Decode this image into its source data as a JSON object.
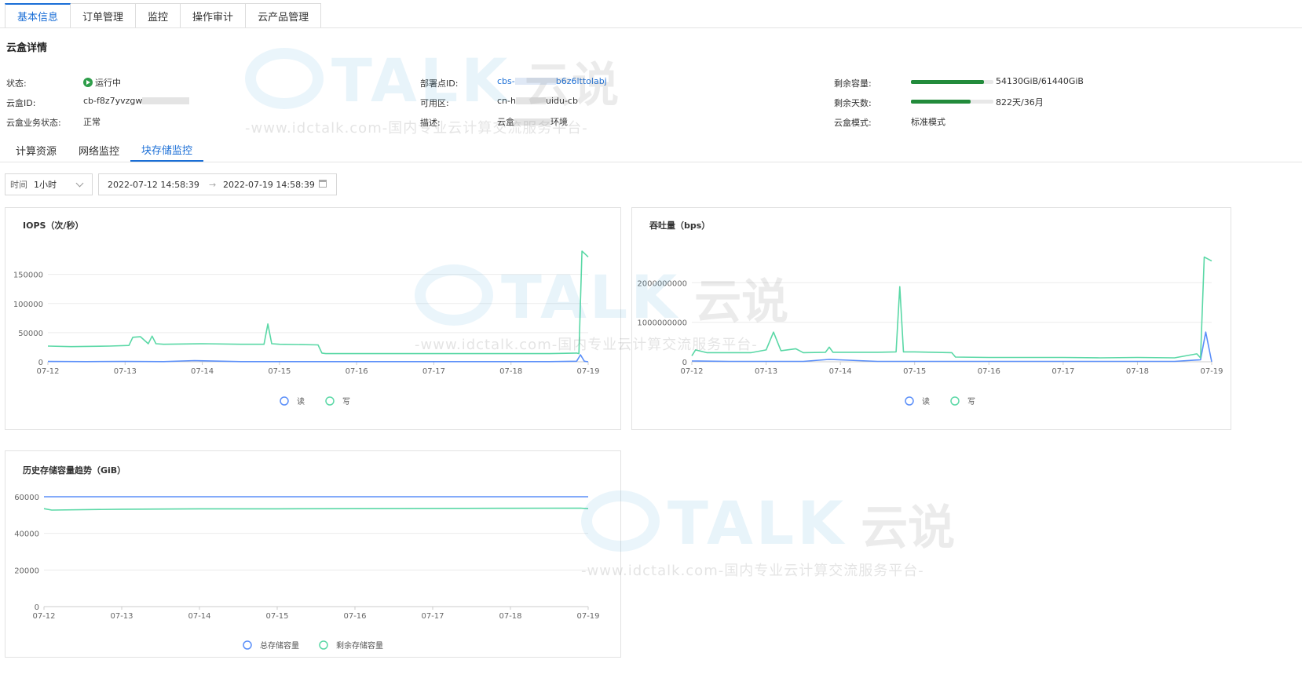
{
  "top_tabs": [
    "基本信息",
    "订单管理",
    "监控",
    "操作审计",
    "云产品管理"
  ],
  "section_title": "云盒详情",
  "info": {
    "status_label": "状态:",
    "status_value": "运行中",
    "id_label": "云盒ID:",
    "id_value": "cb-f8z7yvzgw",
    "biz_status_label": "云盒业务状态:",
    "biz_status_value": "正常",
    "node_label": "部署点ID:",
    "node_value": "cbs-",
    "node_value_tail": "b6z6lttolabj",
    "zone_label": "可用区:",
    "zone_value": "cn-h",
    "zone_value_tail": "uidu-cb",
    "desc_label": "描述:",
    "desc_value": "云盒",
    "desc_value_tail": "环境",
    "capacity_label": "剩余容量:",
    "capacity_value": "54130GiB/61440GiB",
    "capacity_fraction": 0.881,
    "days_label": "剩余天数:",
    "days_value": "822天/36月",
    "days_fraction": 0.72,
    "mode_label": "云盒模式:",
    "mode_value": "标准模式"
  },
  "sub_tabs": [
    "计算资源",
    "网络监控",
    "块存储监控"
  ],
  "filter": {
    "time_label": "时间",
    "time_value": "1小时",
    "start": "2022-07-12 14:58:39",
    "arrow": "→",
    "end": "2022-07-19 14:58:39"
  },
  "watermark": {
    "brand": "TALK",
    "cn": "云说",
    "sub": "-www.idctalk.com-国内专业云计算交流服务平台-"
  },
  "colors": {
    "accent": "#1a6ed6",
    "read": "#5b8ff9",
    "write": "#5ad8a6",
    "progress": "#228b3b"
  },
  "chart_data": [
    {
      "type": "line",
      "title": "IOPS（次/秒）",
      "x_ticks": [
        "07-12",
        "07-13",
        "07-14",
        "07-15",
        "07-16",
        "07-17",
        "07-18",
        "07-19"
      ],
      "y_ticks": [
        0,
        50000,
        100000,
        150000
      ],
      "ylim": [
        0,
        190000
      ],
      "xlim": [
        0,
        7
      ],
      "legend": "bottom",
      "series": [
        {
          "name": "读",
          "color": "#5b8ff9",
          "x": [
            0,
            0.5,
            1,
            1.5,
            1.9,
            2.5,
            3,
            3.5,
            4,
            4.5,
            5,
            5.5,
            6,
            6.5,
            6.85,
            6.9,
            6.95,
            7
          ],
          "y": [
            500,
            300,
            500,
            300,
            2000,
            300,
            300,
            300,
            300,
            300,
            300,
            300,
            300,
            300,
            1000,
            12000,
            1000,
            0
          ]
        },
        {
          "name": "写",
          "color": "#5ad8a6",
          "x": [
            0,
            0.3,
            0.8,
            1.05,
            1.1,
            1.2,
            1.3,
            1.35,
            1.4,
            1.5,
            2,
            2.5,
            2.8,
            2.85,
            2.9,
            3,
            3.5,
            3.55,
            3.6,
            4,
            4.5,
            5,
            5.5,
            6,
            6.5,
            6.85,
            6.88,
            6.92,
            6.96,
            7
          ],
          "y": [
            27000,
            26000,
            27000,
            28000,
            42000,
            43000,
            31000,
            44000,
            31000,
            30000,
            31000,
            30000,
            30000,
            65000,
            31000,
            30000,
            29000,
            15000,
            14000,
            14000,
            14000,
            14000,
            14000,
            14000,
            14000,
            15000,
            14000,
            190000,
            185000,
            180000
          ]
        }
      ]
    },
    {
      "type": "line",
      "title": "吞吐量（bps）",
      "x_ticks": [
        "07-12",
        "07-13",
        "07-14",
        "07-15",
        "07-16",
        "07-17",
        "07-18",
        "07-19"
      ],
      "y_ticks": [
        0,
        1000000000,
        2000000000
      ],
      "ylim": [
        0,
        2800000000
      ],
      "xlim": [
        0,
        7
      ],
      "legend": "bottom",
      "series": [
        {
          "name": "读",
          "color": "#5b8ff9",
          "x": [
            0,
            0.5,
            1,
            1.5,
            1.85,
            2.5,
            3,
            3.5,
            4,
            4.5,
            5,
            5.5,
            6,
            6.5,
            6.85,
            6.92,
            7
          ],
          "y": [
            20000000,
            10000000,
            10000000,
            10000000,
            60000000,
            10000000,
            10000000,
            10000000,
            10000000,
            10000000,
            10000000,
            10000000,
            10000000,
            10000000,
            50000000,
            750000000,
            0
          ]
        },
        {
          "name": "写",
          "color": "#5ad8a6",
          "x": [
            0,
            0.05,
            0.2,
            0.8,
            1,
            1.1,
            1.2,
            1.4,
            1.5,
            1.8,
            1.85,
            1.9,
            2.5,
            2.75,
            2.8,
            2.85,
            3,
            3.5,
            3.55,
            4,
            4.5,
            5,
            5.5,
            6,
            6.5,
            6.8,
            6.85,
            6.9,
            6.95,
            7
          ],
          "y": [
            150000000,
            300000000,
            230000000,
            230000000,
            300000000,
            750000000,
            280000000,
            330000000,
            230000000,
            240000000,
            370000000,
            240000000,
            240000000,
            250000000,
            1900000000,
            250000000,
            250000000,
            230000000,
            120000000,
            110000000,
            110000000,
            110000000,
            100000000,
            110000000,
            100000000,
            200000000,
            100000000,
            2650000000,
            2600000000,
            2550000000
          ]
        }
      ]
    },
    {
      "type": "line",
      "title": "历史存储容量趋势（GiB）",
      "x_ticks": [
        "07-12",
        "07-13",
        "07-14",
        "07-15",
        "07-16",
        "07-17",
        "07-18",
        "07-19"
      ],
      "y_ticks": [
        0,
        20000,
        40000,
        60000
      ],
      "ylim": [
        0,
        60000
      ],
      "xlim": [
        0,
        7
      ],
      "legend": "bottom",
      "series": [
        {
          "name": "总存储容量",
          "color": "#5b8ff9",
          "x": [
            0,
            7
          ],
          "y": [
            61440,
            61440
          ]
        },
        {
          "name": "剩余存储容量",
          "color": "#5ad8a6",
          "x": [
            0,
            0.1,
            1,
            2,
            3,
            4,
            5,
            6,
            6.9,
            7
          ],
          "y": [
            53500,
            52700,
            53200,
            53400,
            53400,
            53500,
            53600,
            53700,
            53800,
            53500
          ]
        }
      ]
    }
  ]
}
